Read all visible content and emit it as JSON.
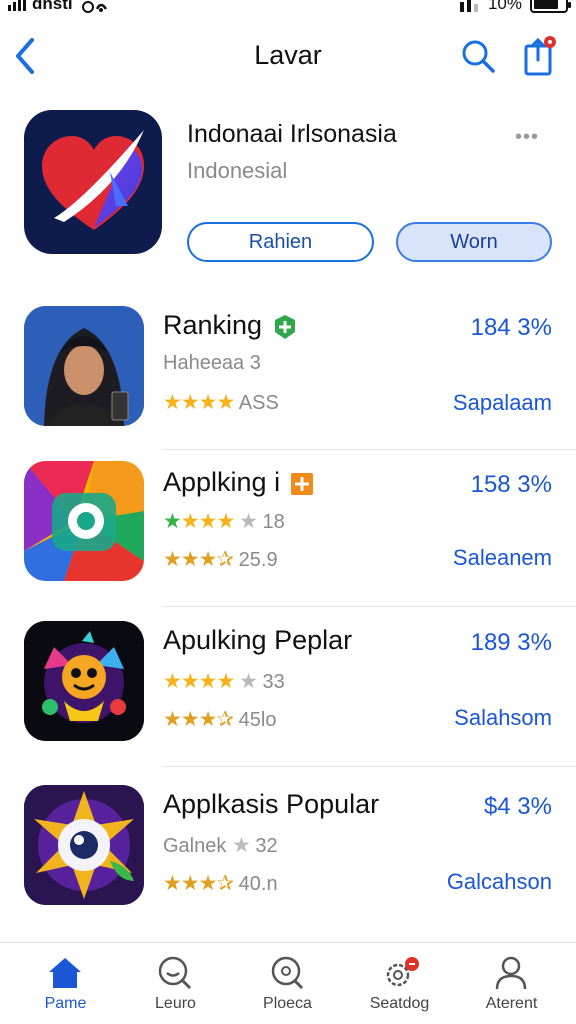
{
  "status_bar": {
    "carrier": "dnsti",
    "battery": "10%"
  },
  "nav": {
    "title": "Lavar"
  },
  "hero": {
    "title": "Indonaai Irlsonasia",
    "subtitle": "Indonesial",
    "more": "•••",
    "button_outline": "Rahien",
    "button_fill": "Worn"
  },
  "apps": [
    {
      "name": "Ranking",
      "sub": "Haheeaa 3",
      "rating_text": "ASS",
      "percent": "184 3%",
      "action": "Sapalaam",
      "badge": "green-plus"
    },
    {
      "name": "Applking i",
      "sub_rating": "18",
      "rating_text": "25.9",
      "percent": "158 3%",
      "action": "Saleanem",
      "badge": "orange-plus"
    },
    {
      "name": "Apulking Peplar",
      "sub_rating": "33",
      "rating_text": "45lo",
      "percent": "189 3%",
      "action": "Salahsom"
    },
    {
      "name": "Applkasis Popular",
      "sub": "Galnek",
      "sub_rating": "32",
      "rating_text": "40.n",
      "percent": "$4 3%",
      "action": "Galcahson"
    }
  ],
  "tabs": [
    {
      "label": "Pame",
      "icon": "home-icon",
      "active": true
    },
    {
      "label": "Leuro",
      "icon": "search-face-icon"
    },
    {
      "label": "Ploeca",
      "icon": "magnifier-icon"
    },
    {
      "label": "Seatdog",
      "icon": "settings-badge-icon"
    },
    {
      "label": "Aterent",
      "icon": "person-icon"
    }
  ],
  "colors": {
    "accent": "#1a56d6",
    "star": "#f5b21b",
    "badge_red": "#e0302a"
  }
}
